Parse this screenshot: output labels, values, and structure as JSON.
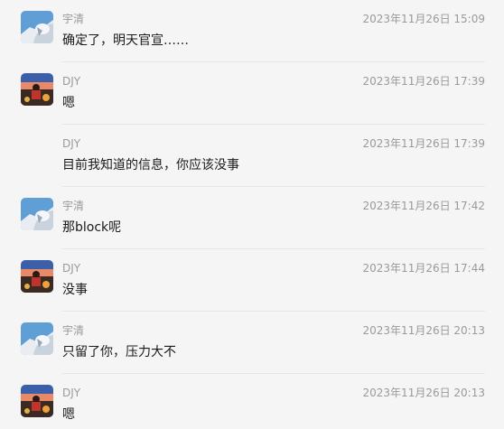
{
  "messages": [
    {
      "sender": "宇清",
      "time": "2023年11月26日 15:09",
      "text": "确定了，明天官宣……",
      "avatar": "snow-avatar"
    },
    {
      "sender": "DJY",
      "time": "2023年11月26日 17:39",
      "text": "嗯",
      "avatar": "sunset-avatar"
    },
    {
      "sender": "DJY",
      "time": "2023年11月26日 17:39",
      "text": "目前我知道的信息，你应该没事",
      "avatar": ""
    },
    {
      "sender": "宇清",
      "time": "2023年11月26日 17:42",
      "text": "那block呢",
      "avatar": "snow-avatar"
    },
    {
      "sender": "DJY",
      "time": "2023年11月26日 17:44",
      "text": "没事",
      "avatar": "sunset-avatar"
    },
    {
      "sender": "宇清",
      "time": "2023年11月26日 20:13",
      "text": "只留了你，压力大不",
      "avatar": "snow-avatar"
    },
    {
      "sender": "DJY",
      "time": "2023年11月26日 20:13",
      "text": "嗯",
      "avatar": "sunset-avatar"
    }
  ]
}
